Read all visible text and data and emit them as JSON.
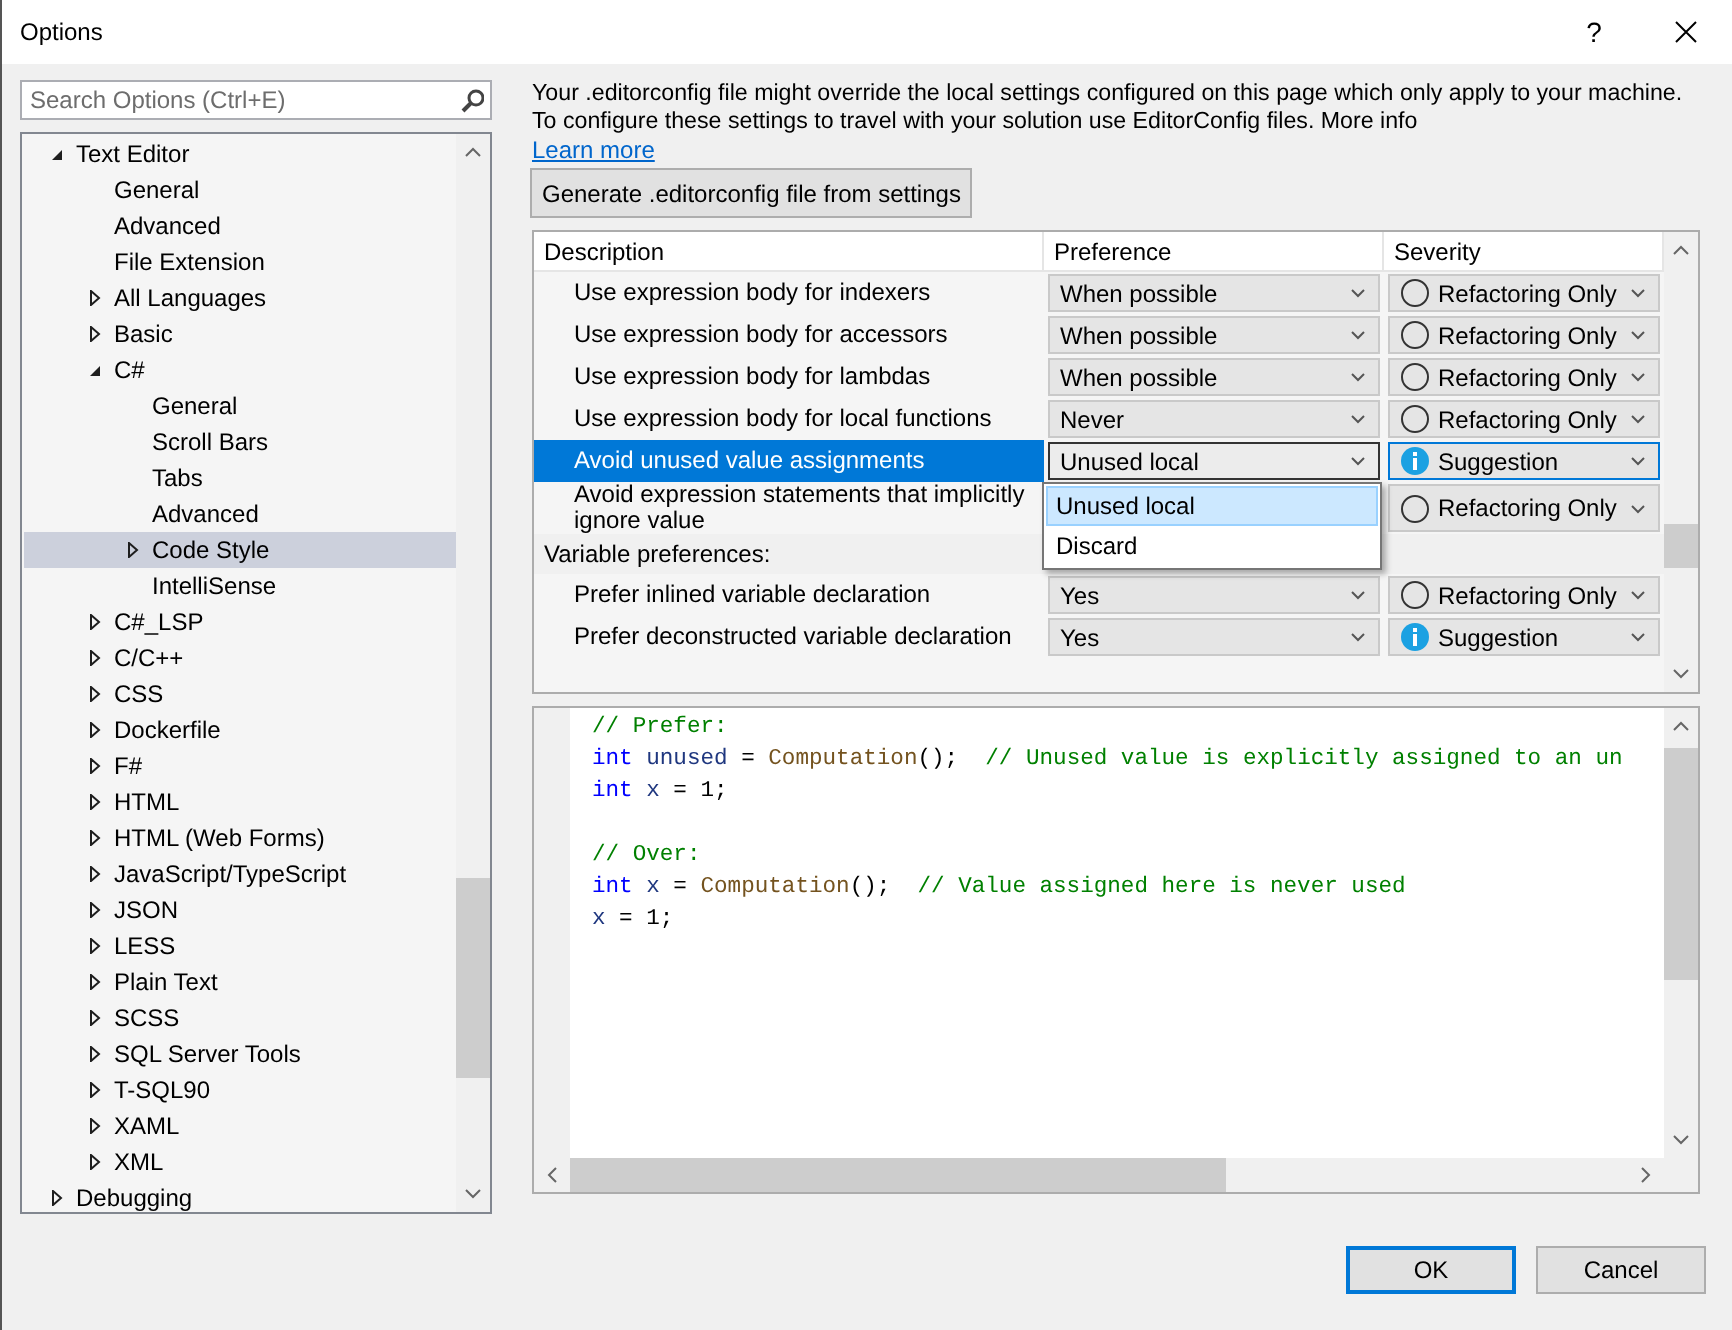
{
  "window": {
    "title": "Options",
    "help": "?"
  },
  "search": {
    "placeholder": "Search Options (Ctrl+E)"
  },
  "tree": [
    {
      "label": "Text Editor",
      "expanded": true,
      "selected": false,
      "children": [
        {
          "label": "General",
          "selected": false
        },
        {
          "label": "Advanced",
          "selected": false
        },
        {
          "label": "File Extension",
          "selected": false
        },
        {
          "label": "All Languages",
          "expanded": false,
          "selected": false
        },
        {
          "label": "Basic",
          "expanded": false,
          "selected": false
        },
        {
          "label": "C#",
          "expanded": true,
          "selected": false,
          "children": [
            {
              "label": "General",
              "selected": false
            },
            {
              "label": "Scroll Bars",
              "selected": false
            },
            {
              "label": "Tabs",
              "selected": false
            },
            {
              "label": "Advanced",
              "selected": false
            },
            {
              "label": "Code Style",
              "expanded": false,
              "selected": true
            },
            {
              "label": "IntelliSense",
              "selected": false
            }
          ]
        },
        {
          "label": "C#_LSP",
          "expanded": false,
          "selected": false
        },
        {
          "label": "C/C++",
          "expanded": false,
          "selected": false
        },
        {
          "label": "CSS",
          "expanded": false,
          "selected": false
        },
        {
          "label": "Dockerfile",
          "expanded": false,
          "selected": false
        },
        {
          "label": "F#",
          "expanded": false,
          "selected": false
        },
        {
          "label": "HTML",
          "expanded": false,
          "selected": false
        },
        {
          "label": "HTML (Web Forms)",
          "expanded": false,
          "selected": false
        },
        {
          "label": "JavaScript/TypeScript",
          "expanded": false,
          "selected": false
        },
        {
          "label": "JSON",
          "expanded": false,
          "selected": false
        },
        {
          "label": "LESS",
          "expanded": false,
          "selected": false
        },
        {
          "label": "Plain Text",
          "expanded": false,
          "selected": false
        },
        {
          "label": "SCSS",
          "expanded": false,
          "selected": false
        },
        {
          "label": "SQL Server Tools",
          "expanded": false,
          "selected": false
        },
        {
          "label": "T-SQL90",
          "expanded": false,
          "selected": false
        },
        {
          "label": "XAML",
          "expanded": false,
          "selected": false
        },
        {
          "label": "XML",
          "expanded": false,
          "selected": false
        }
      ]
    },
    {
      "label": "Debugging",
      "expanded": false,
      "selected": false
    }
  ],
  "notice": {
    "text": "Your .editorconfig file might override the local settings configured on this page which only apply to your machine. To configure these settings to travel with your solution use EditorConfig files. More info",
    "link": "Learn more"
  },
  "generate_button": "Generate .editorconfig file from settings",
  "grid": {
    "columns": [
      "Description",
      "Preference",
      "Severity"
    ],
    "rows": [
      {
        "kind": "setting",
        "description": "Use expression body for indexers",
        "preference": "When possible",
        "severity": "Refactoring Only",
        "severity_info": false,
        "selected": false
      },
      {
        "kind": "setting",
        "description": "Use expression body for accessors",
        "preference": "When possible",
        "severity": "Refactoring Only",
        "severity_info": false,
        "selected": false
      },
      {
        "kind": "setting",
        "description": "Use expression body for lambdas",
        "preference": "When possible",
        "severity": "Refactoring Only",
        "severity_info": false,
        "selected": false
      },
      {
        "kind": "setting",
        "description": "Use expression body for local functions",
        "preference": "Never",
        "severity": "Refactoring Only",
        "severity_info": false,
        "selected": false
      },
      {
        "kind": "setting",
        "description": "Avoid unused value assignments",
        "preference": "Unused local",
        "severity": "Suggestion",
        "severity_info": true,
        "selected": true,
        "dropdown": [
          {
            "label": "Unused local",
            "selected": true
          },
          {
            "label": "Discard",
            "selected": false
          }
        ]
      },
      {
        "kind": "setting",
        "description": "Avoid expression statements that implicitly ignore value",
        "severity": "Refactoring Only",
        "severity_info": false,
        "selected": false
      },
      {
        "kind": "group",
        "description": "Variable preferences:"
      },
      {
        "kind": "setting",
        "description": "Prefer inlined variable declaration",
        "preference": "Yes",
        "severity": "Refactoring Only",
        "severity_info": false,
        "selected": false
      },
      {
        "kind": "setting",
        "description": "Prefer deconstructed variable declaration",
        "preference": "Yes",
        "severity": "Suggestion",
        "severity_info": true,
        "selected": false
      }
    ]
  },
  "code": [
    {
      "tokens": [
        {
          "kind": "comment",
          "text": "// Prefer:"
        }
      ]
    },
    {
      "tokens": [
        {
          "kind": "keyword",
          "text": "int "
        },
        {
          "kind": "ident",
          "text": "unused"
        },
        {
          "kind": "plain",
          "text": " = "
        },
        {
          "kind": "method",
          "text": "Computation"
        },
        {
          "kind": "plain",
          "text": "();  "
        },
        {
          "kind": "comment",
          "text": "// Unused value is explicitly assigned to an un"
        }
      ]
    },
    {
      "tokens": [
        {
          "kind": "keyword",
          "text": "int "
        },
        {
          "kind": "ident",
          "text": "x"
        },
        {
          "kind": "plain",
          "text": " = 1;"
        }
      ]
    },
    {
      "gap_before": true,
      "tokens": [
        {
          "kind": "comment",
          "text": "// Over:"
        }
      ]
    },
    {
      "tokens": [
        {
          "kind": "keyword",
          "text": "int "
        },
        {
          "kind": "ident",
          "text": "x"
        },
        {
          "kind": "plain",
          "text": " = "
        },
        {
          "kind": "method",
          "text": "Computation"
        },
        {
          "kind": "plain",
          "text": "();  "
        },
        {
          "kind": "comment",
          "text": "// Value assigned here is never used"
        }
      ]
    },
    {
      "tokens": [
        {
          "kind": "ident",
          "text": "x"
        },
        {
          "kind": "plain",
          "text": " = 1;"
        }
      ]
    }
  ],
  "buttons": [
    {
      "label": "OK",
      "default": true
    },
    {
      "label": "Cancel",
      "default": false
    }
  ]
}
